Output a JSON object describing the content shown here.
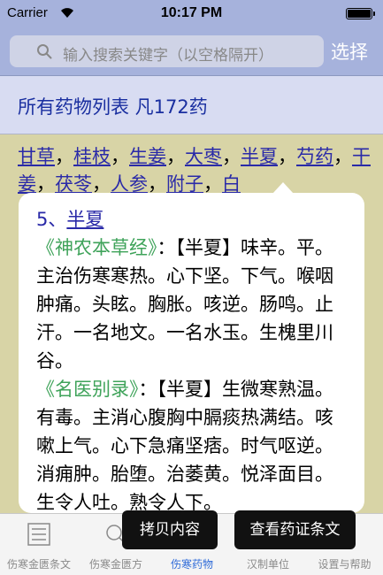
{
  "status_bar": {
    "carrier": "Carrier",
    "time": "10:17 PM"
  },
  "search": {
    "placeholder": "输入搜索关键字（以空格隔开）",
    "select_label": "选择"
  },
  "list_header": {
    "title": "所有药物列表  凡172药"
  },
  "herbs": [
    "甘草",
    "桂枝",
    "生姜",
    "大枣",
    "半夏",
    "芍药",
    "干姜",
    "茯苓",
    "人参",
    "附子",
    "白"
  ],
  "popover": {
    "index": "5、",
    "name": "半夏",
    "entries": [
      {
        "source": "《神农本草经》",
        "text": "：【半夏】味辛。平。主治伤寒寒热。心下坚。下气。喉咽肿痛。头眩。胸胀。咳逆。肠鸣。止汗。一名地文。一名水玉。生槐里川谷。"
      },
      {
        "source": "《名医别录》",
        "text": "：【半夏】生微寒熟温。有毒。主消心腹胸中膈痰热满结。咳嗽上气。心下急痛坚痞。时气呕逆。消痈肿。胎堕。治萎黄。悦泽面目。生令人吐。熟令人下。"
      }
    ],
    "ellipsis": "……"
  },
  "actions": {
    "copy": "拷贝内容",
    "view": "查看药证条文"
  },
  "tabs": [
    {
      "label": "伤寒金匮条文",
      "active": false
    },
    {
      "label": "伤寒金匮方",
      "active": false
    },
    {
      "label": "伤寒药物",
      "active": true
    },
    {
      "label": "汉制单位",
      "active": false
    },
    {
      "label": "设置与帮助",
      "active": false
    }
  ],
  "colors": {
    "nav_bg": "#a6b2dc",
    "list_bg": "#d8d4a6",
    "link": "#2a2aa8",
    "source_green": "#3fa35a",
    "active_tab": "#2f6bd8"
  }
}
